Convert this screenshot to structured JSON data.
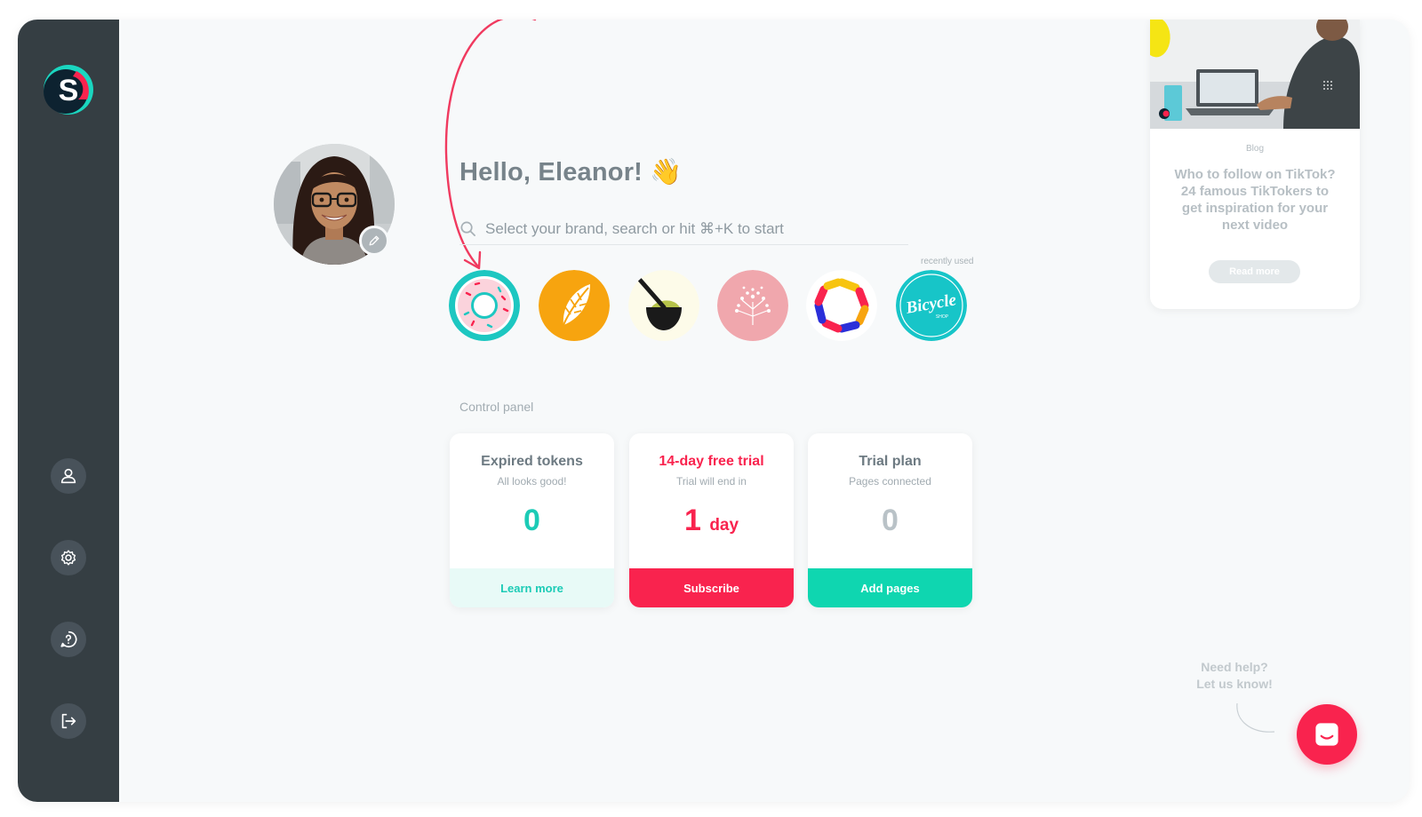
{
  "greeting": "Hello, Eleanor! 👋",
  "search": {
    "placeholder": "Select your brand, search or hit ⌘+K to start"
  },
  "recent_label": "recently used",
  "brands": [
    {
      "name": "donut-brand"
    },
    {
      "name": "leaf-brand"
    },
    {
      "name": "bowl-brand"
    },
    {
      "name": "flower-brand"
    },
    {
      "name": "ring-brand"
    },
    {
      "name": "bicycle-brand",
      "text": "Bicycle",
      "subtext": "SHOP"
    }
  ],
  "control_panel": {
    "title": "Control panel",
    "cards": [
      {
        "title": "Expired tokens",
        "subtitle": "All looks good!",
        "value": "0",
        "unit": "",
        "button": "Learn more",
        "title_color": "#6d7a82",
        "value_color": "#1ccbb6",
        "button_bg": "#e8faf7",
        "button_color": "#1ccbb6"
      },
      {
        "title": "14-day free trial",
        "subtitle": "Trial will end in",
        "value": "1",
        "unit": "day",
        "button": "Subscribe",
        "title_color": "#f9234e",
        "value_color": "#f9234e",
        "button_bg": "#f9234e",
        "button_color": "#ffffff"
      },
      {
        "title": "Trial plan",
        "subtitle": "Pages connected",
        "value": "0",
        "unit": "",
        "button": "Add pages",
        "title_color": "#6d7a82",
        "value_color": "#b9c2c7",
        "button_bg": "#0fd6b0",
        "button_color": "#ffffff"
      }
    ]
  },
  "blog": {
    "tag": "Blog",
    "title": "Who to follow on TikTok? 24 famous TikTokers to get inspiration for your next video",
    "button": "Read more"
  },
  "help": {
    "line1": "Need help?",
    "line2": "Let us know!"
  },
  "colors": {
    "sidebar": "#353e43",
    "accent": "#f9234e",
    "teal": "#1ccbb6"
  },
  "sidebar_icons": [
    "user-icon",
    "gear-icon",
    "help-icon",
    "logout-icon"
  ]
}
